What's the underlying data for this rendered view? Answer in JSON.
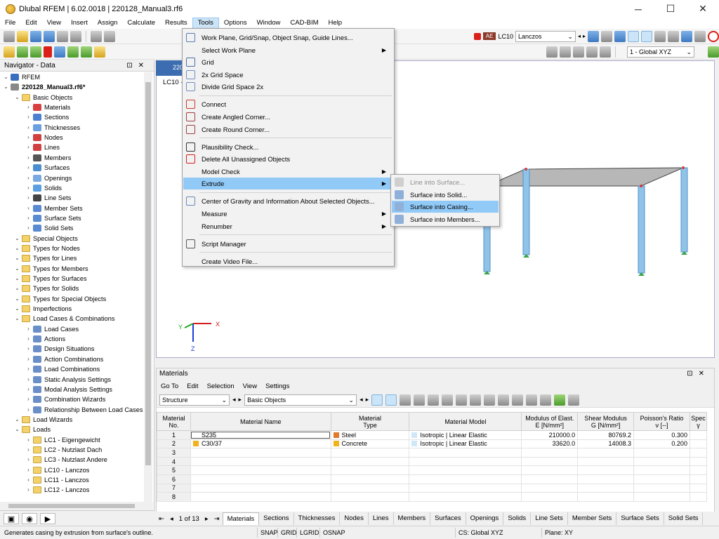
{
  "app": {
    "title": "Dlubal RFEM | 6.02.0018 | 220128_Manual3.rf6"
  },
  "window": {
    "minimize": "─",
    "maximize": "☐",
    "close": "✕"
  },
  "menu": [
    "File",
    "Edit",
    "View",
    "Insert",
    "Assign",
    "Calculate",
    "Results",
    "Tools",
    "Options",
    "Window",
    "CAD-BIM",
    "Help"
  ],
  "toolbar": {
    "lc_badge": "AE",
    "lc_name": "LC10",
    "lc_method": "Lanczos",
    "coord_system": "1 - Global XYZ"
  },
  "navigator": {
    "title": "Navigator - Data",
    "items": [
      {
        "label": "RFEM",
        "level": 0,
        "icon": "rfem-icon"
      },
      {
        "label": "220128_Manual3.rf6*",
        "level": 0,
        "icon": "model-icon",
        "bold": true
      },
      {
        "label": "Basic Objects",
        "level": 1,
        "icon": "folder"
      },
      {
        "label": "Materials",
        "level": 2,
        "icon": "materials-icon"
      },
      {
        "label": "Sections",
        "level": 2,
        "icon": "sections-icon"
      },
      {
        "label": "Thicknesses",
        "level": 2,
        "icon": "thickness-icon"
      },
      {
        "label": "Nodes",
        "level": 2,
        "icon": "nodes-icon"
      },
      {
        "label": "Lines",
        "level": 2,
        "icon": "lines-icon"
      },
      {
        "label": "Members",
        "level": 2,
        "icon": "members-icon"
      },
      {
        "label": "Surfaces",
        "level": 2,
        "icon": "surfaces-icon"
      },
      {
        "label": "Openings",
        "level": 2,
        "icon": "openings-icon"
      },
      {
        "label": "Solids",
        "level": 2,
        "icon": "solids-icon"
      },
      {
        "label": "Line Sets",
        "level": 2,
        "icon": "linesets-icon"
      },
      {
        "label": "Member Sets",
        "level": 2,
        "icon": "membersets-icon"
      },
      {
        "label": "Surface Sets",
        "level": 2,
        "icon": "surfacesets-icon"
      },
      {
        "label": "Solid Sets",
        "level": 2,
        "icon": "solidsets-icon"
      },
      {
        "label": "Special Objects",
        "level": 1,
        "icon": "folder"
      },
      {
        "label": "Types for Nodes",
        "level": 1,
        "icon": "folder"
      },
      {
        "label": "Types for Lines",
        "level": 1,
        "icon": "folder"
      },
      {
        "label": "Types for Members",
        "level": 1,
        "icon": "folder"
      },
      {
        "label": "Types for Surfaces",
        "level": 1,
        "icon": "folder"
      },
      {
        "label": "Types for Solids",
        "level": 1,
        "icon": "folder"
      },
      {
        "label": "Types for Special Objects",
        "level": 1,
        "icon": "folder"
      },
      {
        "label": "Imperfections",
        "level": 1,
        "icon": "folder"
      },
      {
        "label": "Load Cases & Combinations",
        "level": 1,
        "icon": "folder"
      },
      {
        "label": "Load Cases",
        "level": 2,
        "icon": "loadcases-icon"
      },
      {
        "label": "Actions",
        "level": 2,
        "icon": "actions-icon"
      },
      {
        "label": "Design Situations",
        "level": 2,
        "icon": "design-situations-icon"
      },
      {
        "label": "Action Combinations",
        "level": 2,
        "icon": "action-combinations-icon"
      },
      {
        "label": "Load Combinations",
        "level": 2,
        "icon": "load-combinations-icon"
      },
      {
        "label": "Static Analysis Settings",
        "level": 2,
        "icon": "static-settings-icon"
      },
      {
        "label": "Modal Analysis Settings",
        "level": 2,
        "icon": "modal-settings-icon"
      },
      {
        "label": "Combination Wizards",
        "level": 2,
        "icon": "wizard-icon"
      },
      {
        "label": "Relationship Between Load Cases",
        "level": 2,
        "icon": "relationship-icon"
      },
      {
        "label": "Load Wizards",
        "level": 1,
        "icon": "folder"
      },
      {
        "label": "Loads",
        "level": 1,
        "icon": "folder"
      },
      {
        "label": "LC1 - Eigengewicht",
        "level": 2,
        "icon": "folder"
      },
      {
        "label": "LC2 - Nutzlast Dach",
        "level": 2,
        "icon": "folder"
      },
      {
        "label": "LC3 - Nutzlast Andere",
        "level": 2,
        "icon": "folder"
      },
      {
        "label": "LC10 - Lanczos",
        "level": 2,
        "icon": "folder"
      },
      {
        "label": "LC11 - Lanczos",
        "level": 2,
        "icon": "folder"
      },
      {
        "label": "LC12 - Lanczos",
        "level": 2,
        "icon": "folder"
      }
    ]
  },
  "viewport": {
    "tab_label": "220",
    "lc_label": "LC10 -",
    "axes": {
      "x": "X",
      "y": "Y",
      "z": "Z"
    }
  },
  "tools_menu": [
    {
      "label": "Work Plane, Grid/Snap, Object Snap, Guide Lines...",
      "icon": "workplane-icon"
    },
    {
      "label": "Select Work Plane",
      "icon": "",
      "sub": true
    },
    {
      "label": "Grid",
      "icon": "grid-icon"
    },
    {
      "label": "2x Grid Space",
      "icon": "grid2x-icon"
    },
    {
      "label": "Divide Grid Space 2x",
      "icon": "grid-divide-icon",
      "sep_after": true
    },
    {
      "label": "Connect",
      "icon": "connect-icon"
    },
    {
      "label": "Create Angled Corner...",
      "icon": "angled-corner-icon"
    },
    {
      "label": "Create Round Corner...",
      "icon": "round-corner-icon",
      "sep_after": true
    },
    {
      "label": "Plausibility Check...",
      "icon": "glasses-icon"
    },
    {
      "label": "Delete All Unassigned Objects",
      "icon": "delete-unassigned-icon"
    },
    {
      "label": "Model Check",
      "icon": "",
      "sub": true
    },
    {
      "label": "Extrude",
      "icon": "",
      "sub": true,
      "highlight": true,
      "sep_after": true
    },
    {
      "label": "Center of Gravity and Information About Selected Objects...",
      "icon": "center-gravity-icon"
    },
    {
      "label": "Measure",
      "icon": "",
      "sub": true
    },
    {
      "label": "Renumber",
      "icon": "",
      "sub": true,
      "sep_after": true
    },
    {
      "label": "Script Manager",
      "icon": "script-icon",
      "sep_after": true
    },
    {
      "label": "Create Video File...",
      "icon": ""
    }
  ],
  "extrude_menu": [
    {
      "label": "Line into Surface...",
      "disabled": true
    },
    {
      "label": "Surface into Solid..."
    },
    {
      "label": "Surface into Casing...",
      "highlight": true
    },
    {
      "label": "Surface into Members..."
    }
  ],
  "materials": {
    "title": "Materials",
    "menu": [
      "Go To",
      "Edit",
      "Selection",
      "View",
      "Settings"
    ],
    "filter1": "Structure",
    "filter2": "Basic Objects",
    "columns": [
      "Material\nNo.",
      "Material Name",
      "Material\nType",
      "Material Model",
      "Modulus of Elast.\nE [N/mm²]",
      "Shear Modulus\nG [N/mm²]",
      "Poisson's Ratio\nν [--]",
      "Spec\nγ"
    ],
    "rows": [
      {
        "no": "1",
        "name": "S235",
        "type": "Steel",
        "type_color": "#e07a2c",
        "model": "Isotropic | Linear Elastic",
        "E": "210000.0",
        "G": "80769.2",
        "nu": "0.300",
        "name_color": ""
      },
      {
        "no": "2",
        "name": "C30/37",
        "type": "Concrete",
        "type_color": "#f2b21a",
        "model": "Isotropic | Linear Elastic",
        "E": "33620.0",
        "G": "14008.3",
        "nu": "0.200",
        "name_color": "#f2b21a"
      },
      {
        "no": "3"
      },
      {
        "no": "4"
      },
      {
        "no": "5"
      },
      {
        "no": "6"
      },
      {
        "no": "7"
      },
      {
        "no": "8"
      }
    ],
    "pager": "1 of 13"
  },
  "sheet_tabs": [
    "Materials",
    "Sections",
    "Thicknesses",
    "Nodes",
    "Lines",
    "Members",
    "Surfaces",
    "Openings",
    "Solids",
    "Line Sets",
    "Member Sets",
    "Surface Sets",
    "Solid Sets"
  ],
  "status": {
    "message": "Generates casing by extrusion from surface's outline.",
    "flags": [
      "SNAP",
      "GRID",
      "LGRID",
      "OSNAP"
    ],
    "cs": "CS: Global XYZ",
    "plane": "Plane: XY"
  }
}
